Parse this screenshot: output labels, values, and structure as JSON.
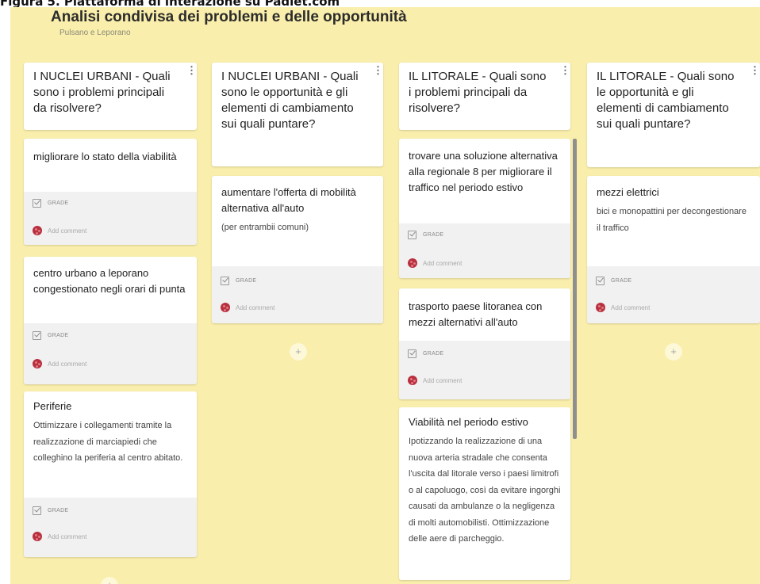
{
  "figure_caption": "Figura 5. Piattaforma di interazione su Padlet.com",
  "board": {
    "title": "Analisi condivisa dei problemi e delle opportunità",
    "subtitle": "Pulsano e Leporano",
    "background_color": "#f9eeab"
  },
  "card_actions": {
    "grade_label": "GRADE",
    "comment_placeholder": "Add comment",
    "add_post_symbol": "+",
    "menu_symbol": "⋮"
  },
  "columns": [
    {
      "title": "I NUCLEI URBANI - Quali sono i problemi principali da risolvere?",
      "cards": [
        {
          "title": "migliorare lo stato della viabilità",
          "description": ""
        },
        {
          "title": "centro urbano a leporano congestionato negli orari di punta",
          "description": ""
        },
        {
          "title": "Periferie",
          "description": "Ottimizzare i collegamenti tramite la realizzazione di marciapiedi che colleghino la periferia al centro abitato."
        }
      ]
    },
    {
      "title": "I NUCLEI URBANI - Quali sono le opportunità e gli elementi di cambiamento sui quali puntare?",
      "cards": [
        {
          "title": "aumentare l'offerta di mobilità alternativa all'auto",
          "description": "(per entrambii comuni)"
        }
      ]
    },
    {
      "title": "IL LITORALE - Quali sono i problemi principali da risolvere?",
      "cards": [
        {
          "title": "trovare una soluzione alternativa alla regionale 8 per migliorare il traffico nel periodo estivo",
          "description": ""
        },
        {
          "title": "trasporto paese litoranea con mezzi alternativi all'auto",
          "description": ""
        },
        {
          "title": "Viabilità nel periodo estivo",
          "description": "Ipotizzando la realizzazione di una nuova arteria stradale che consenta l'uscita dal litorale verso i paesi limitrofi o al capoluogo, così da evitare ingorghi causati da ambulanze o la negligenza di molti automobilisti. Ottimizzazione delle aere di parcheggio."
        }
      ]
    },
    {
      "title": "IL LITORALE - Quali sono le opportunità e gli elementi di cambiamento sui quali puntare?",
      "cards": [
        {
          "title": "mezzi elettrici",
          "description": "bici e monopattini per decongestionare il traffico"
        }
      ]
    }
  ]
}
